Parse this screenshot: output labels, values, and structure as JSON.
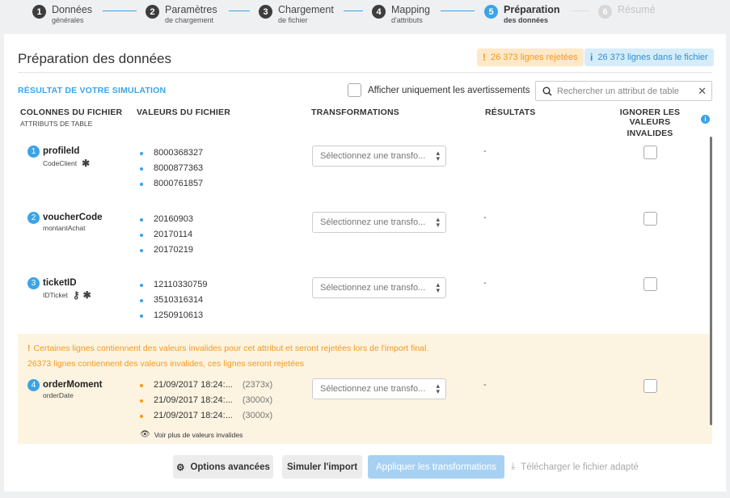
{
  "stepper": [
    {
      "num": "1",
      "title": "Données",
      "sub": "générales"
    },
    {
      "num": "2",
      "title": "Paramètres",
      "sub": "de chargement"
    },
    {
      "num": "3",
      "title": "Chargement",
      "sub": "de fichier"
    },
    {
      "num": "4",
      "title": "Mapping",
      "sub": "d'attributs"
    },
    {
      "num": "5",
      "title": "Préparation",
      "sub": "des données"
    },
    {
      "num": "6",
      "title": "Résumé",
      "sub": ""
    }
  ],
  "page": {
    "title": "Préparation des données",
    "rejected_badge": "26 373 lignes rejetées",
    "total_badge": "26 373 lignes dans le fichier",
    "simulation_title": "RÉSULTAT DE VOTRE SIMULATION",
    "warnings_only_label": "Afficher uniquement les avertissements",
    "search_placeholder": "Rechercher un attribut de table"
  },
  "columns": {
    "file_columns": "COLONNES DU FICHIER",
    "table_attributes": "ATTRIBUTS DE TABLE",
    "file_values": "VALEURS DU FICHIER",
    "transformations": "TRANSFORMATIONS",
    "results": "RÉSULTATS",
    "ignore_line1": "IGNORER LES VALEURS",
    "ignore_line2": "INVALIDES"
  },
  "select_placeholder": "Sélectionnez une transfo...",
  "rows": [
    {
      "num": "1",
      "attr": "profileId",
      "sub": "CodeClient",
      "values": [
        "8000368327",
        "8000877363",
        "8000761857"
      ],
      "result": "-"
    },
    {
      "num": "2",
      "attr": "voucherCode",
      "sub": "montantAchat",
      "values": [
        "20160903",
        "20170114",
        "20170219"
      ],
      "result": "-"
    },
    {
      "num": "3",
      "attr": "ticketID",
      "sub": "IDTicket",
      "values": [
        "12110330759",
        "3510316314",
        "1250910613"
      ],
      "result": "-"
    },
    {
      "num": "4",
      "attr": "orderMoment",
      "sub": "orderDate",
      "values": [
        "21/09/2017 18:24:...",
        "21/09/2017 18:24:...",
        "21/09/2017 18:24:..."
      ],
      "counts": [
        "(2373x)",
        "(3000x)",
        "(3000x)"
      ],
      "result": "-"
    }
  ],
  "warning": {
    "line1": "Certaines lignes contiennent des valeurs invalides pour cet attribut et seront rejetées lors de l'import final.",
    "line2": "26373 lignes contiennent des valeurs invalides, ces lignes seront rejetées",
    "more_link": "Voir plus de valeurs invalides"
  },
  "buttons": {
    "advanced": "Options avancées",
    "simulate": "Simuler l'import",
    "apply": "Appliquer les transformations",
    "download": "Télécharger le fichier adapté"
  },
  "colors": {
    "accent": "#3ba3e6",
    "warning": "#f39a1d"
  }
}
